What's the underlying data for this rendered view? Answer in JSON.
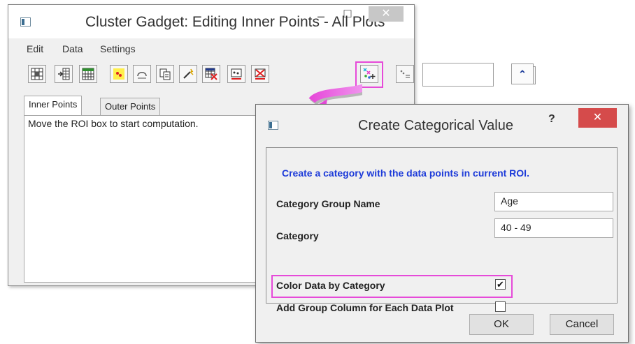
{
  "main_window": {
    "title": "Cluster Gadget: Editing Inner Points - All Plots",
    "minimize_glyph": "–",
    "maximize_glyph": "□",
    "close_glyph": "✕",
    "menu": [
      "Edit",
      "Data",
      "Settings"
    ],
    "toolbar_icons": [
      "grid-layout-icon",
      "add-column-icon",
      "table-icon",
      "scatter-points-icon",
      "undo-curve-icon",
      "copy-icon",
      "magic-wand-icon",
      "remove-data-icon",
      "mask-points-icon",
      "unmask-points-icon",
      "create-categorical-value-icon",
      "legend-icon",
      "collapse-up-icon"
    ],
    "collapse_glyph": "⌃",
    "tabs": [
      "Inner Points",
      "Outer Points"
    ],
    "active_tab": "Inner Points",
    "status_message": "Move the ROI box to start computation."
  },
  "dialog": {
    "title": "Create Categorical Value",
    "help_glyph": "?",
    "close_glyph": "✕",
    "instruction": "Create a category with the data points in current ROI.",
    "fields": {
      "category_group_name": {
        "label": "Category Group Name",
        "value": "Age"
      },
      "category": {
        "label": "Category",
        "value": "40 - 49"
      }
    },
    "checkboxes": {
      "color_data": {
        "label": "Color Data by Category",
        "checked": true,
        "mark": "✔"
      },
      "add_group_column": {
        "label": "Add Group Column for Each Data Plot",
        "checked": false
      }
    },
    "buttons": {
      "ok": "OK",
      "cancel": "Cancel"
    }
  },
  "colors": {
    "highlight": "#e64ad9",
    "instruction_blue": "#1d3bd9",
    "close_red": "#d54b4b"
  }
}
